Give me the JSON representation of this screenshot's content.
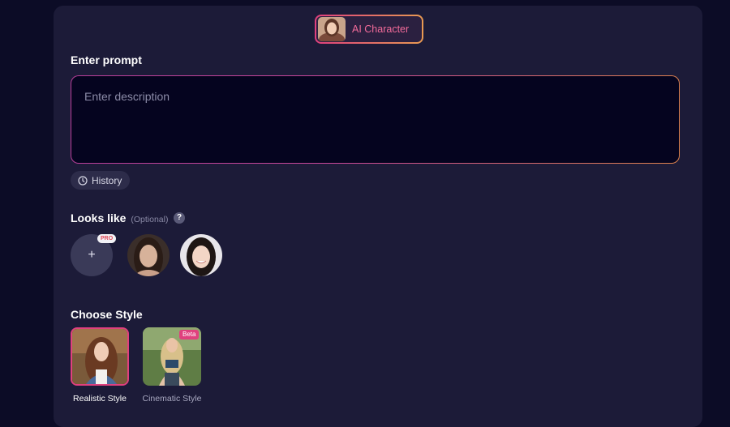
{
  "mode": {
    "label": "AI Character",
    "thumbnail_icon": "character-portrait"
  },
  "prompt": {
    "title": "Enter prompt",
    "placeholder": "Enter description",
    "value": ""
  },
  "history": {
    "label": "History",
    "icon": "clock-icon"
  },
  "looks_like": {
    "title": "Looks like",
    "optional_label": "(Optional)",
    "help_label": "?",
    "add_label": "+",
    "pro_badge": "PRO",
    "faces": [
      "face-1",
      "face-2"
    ]
  },
  "choose_style": {
    "title": "Choose Style",
    "styles": [
      {
        "label": "Realistic Style",
        "selected": true
      },
      {
        "label": "Cinematic Style",
        "selected": false,
        "badge": "Beta"
      }
    ]
  },
  "colors": {
    "accent_pink": "#e0407e",
    "accent_orange": "#e89a52",
    "panel": "#1c1b38",
    "background": "#0c0c26"
  }
}
